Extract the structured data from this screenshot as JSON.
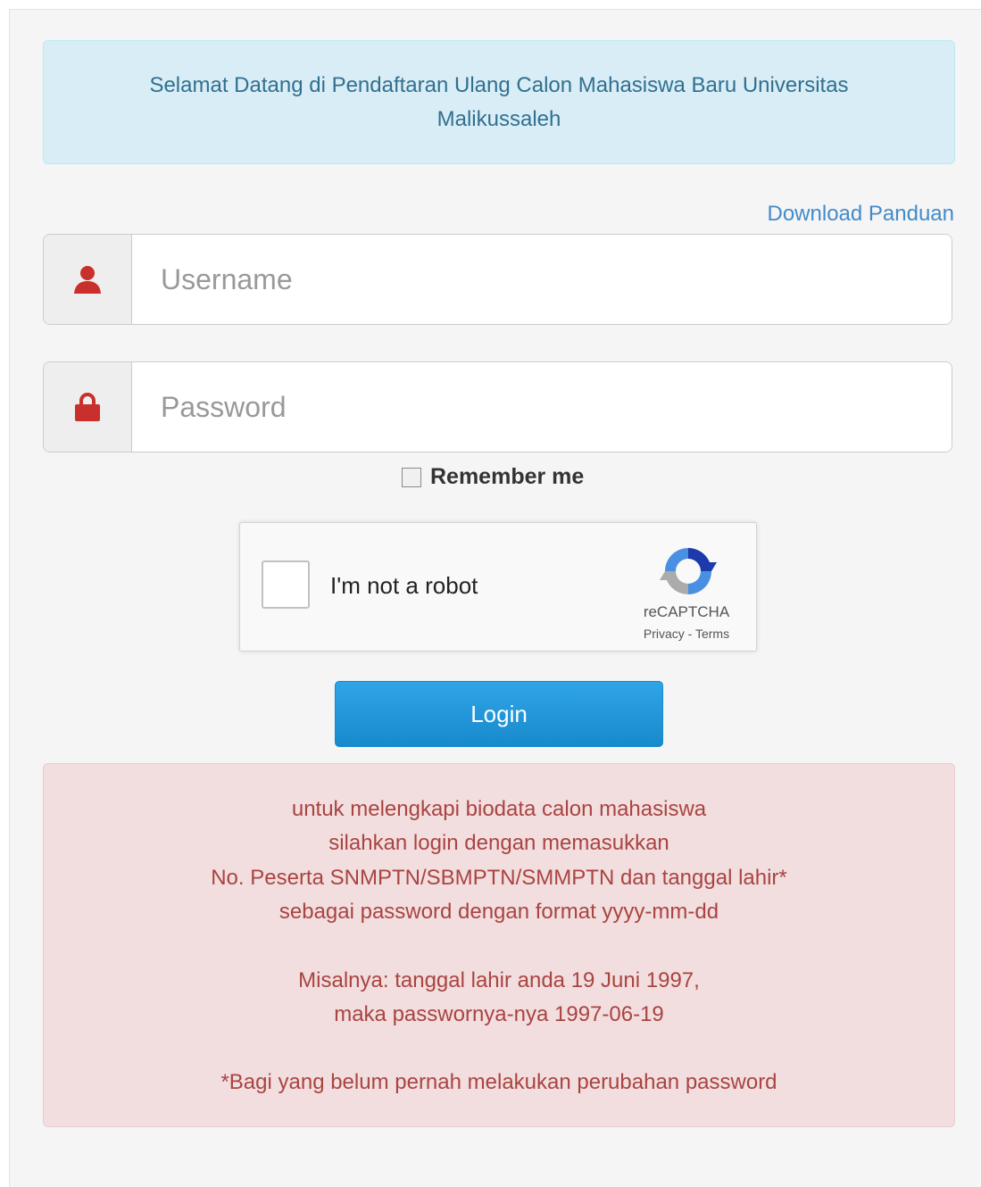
{
  "welcome": {
    "text": "Selamat Datang di Pendaftaran Ulang Calon Mahasiswa Baru Universitas Malikussaleh"
  },
  "links": {
    "download": "Download Panduan"
  },
  "form": {
    "username_placeholder": "Username",
    "password_placeholder": "Password",
    "remember_label": "Remember me",
    "login_label": "Login"
  },
  "captcha": {
    "label": "I'm not a robot",
    "brand": "reCAPTCHA",
    "terms": "Privacy - Terms"
  },
  "info": {
    "lines": [
      "untuk melengkapi biodata calon mahasiswa",
      "silahkan login dengan memasukkan",
      "No. Peserta SNMPTN/SBMPTN/SMMPTN dan tanggal lahir*",
      "sebagai password dengan format yyyy-mm-dd"
    ],
    "example_lines": [
      "Misalnya: tanggal lahir anda 19 Juni 1997,",
      "maka passwornya-nya 1997-06-19"
    ],
    "footnote": "*Bagi yang belum pernah melakukan perubahan password"
  },
  "colors": {
    "icon_red": "#c9302c",
    "button_blue": "#2fa4e7",
    "info_text": "#a94442",
    "welcome_text": "#31708f"
  },
  "icons": {
    "username": "user-icon",
    "password": "lock-icon",
    "captcha": "recaptcha-logo-icon"
  }
}
